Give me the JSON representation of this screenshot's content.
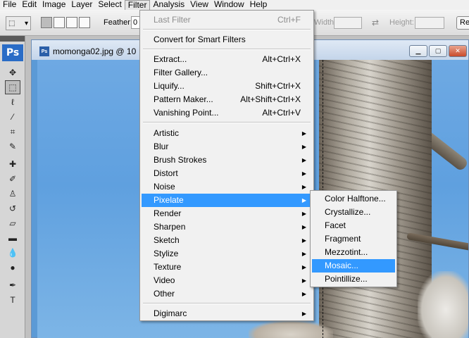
{
  "menubar": {
    "items": [
      "File",
      "Edit",
      "Image",
      "Layer",
      "Select",
      "Filter",
      "Analysis",
      "View",
      "Window",
      "Help"
    ],
    "active": "Filter"
  },
  "options": {
    "feather_label": "Feather:",
    "feather_value": "0",
    "width_label": "Width:",
    "height_label": "Height:",
    "refine_label": "Re"
  },
  "tools": {
    "logo": "Ps"
  },
  "document": {
    "title": "momonga02.jpg @ 10"
  },
  "filter_menu": {
    "last_filter": "Last Filter",
    "last_filter_shortcut": "Ctrl+F",
    "convert": "Convert for Smart Filters",
    "commands": [
      {
        "label": "Extract...",
        "shortcut": "Alt+Ctrl+X"
      },
      {
        "label": "Filter Gallery...",
        "shortcut": ""
      },
      {
        "label": "Liquify...",
        "shortcut": "Shift+Ctrl+X"
      },
      {
        "label": "Pattern Maker...",
        "shortcut": "Alt+Shift+Ctrl+X"
      },
      {
        "label": "Vanishing Point...",
        "shortcut": "Alt+Ctrl+V"
      }
    ],
    "groups": [
      "Artistic",
      "Blur",
      "Brush Strokes",
      "Distort",
      "Noise",
      "Pixelate",
      "Render",
      "Sharpen",
      "Sketch",
      "Stylize",
      "Texture",
      "Video",
      "Other"
    ],
    "highlighted_group": "Pixelate",
    "digimarc": "Digimarc"
  },
  "pixelate_submenu": {
    "items": [
      "Color Halftone...",
      "Crystallize...",
      "Facet",
      "Fragment",
      "Mezzotint...",
      "Mosaic...",
      "Pointillize..."
    ],
    "highlighted": "Mosaic..."
  },
  "colors": {
    "highlight": "#3399ff",
    "menu_bg": "#f1f1f1",
    "sky": "#5fa0df"
  },
  "icons": [
    "marquee-icon",
    "move-icon",
    "lasso-icon",
    "magic-wand-icon",
    "crop-icon",
    "slice-icon",
    "healing-brush-icon",
    "brush-icon",
    "clone-stamp-icon",
    "history-brush-icon",
    "eraser-icon",
    "gradient-icon",
    "blur-icon",
    "dodge-icon",
    "pen-icon",
    "type-icon"
  ]
}
